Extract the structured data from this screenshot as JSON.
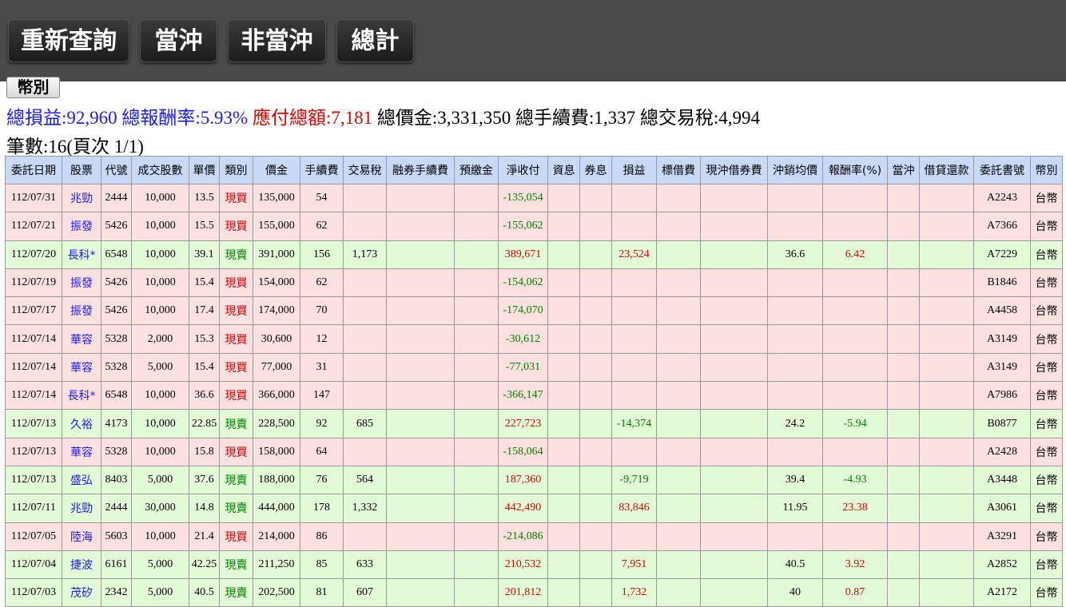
{
  "toolbar": {
    "requery": "重新查詢",
    "daytrade": "當沖",
    "nondaytrade": "非當沖",
    "total": "總計"
  },
  "currency_button": "幣別",
  "summary": {
    "total_pl": "總損益:92,960",
    "total_return": "總報酬率:5.93%",
    "total_payable": "應付總額:7,181",
    "total_amount": "總價金:3,331,350",
    "total_fee": "總手續費:1,337",
    "total_tax": "總交易稅:4,994"
  },
  "count_text": "筆數:16(頁次 1/1)",
  "table": {
    "headers": [
      "委託日期",
      "股票",
      "代號",
      "成交股數",
      "單價",
      "類別",
      "價金",
      "手續費",
      "交易稅",
      "融券手續費",
      "預繳金",
      "淨收付",
      "資息",
      "券息",
      "損益",
      "標借費",
      "現沖借券費",
      "沖銷均價",
      "報酬率(%)",
      "當沖",
      "借貸還款",
      "委託書號",
      "幣別"
    ],
    "rows": [
      {
        "type": "buy",
        "cells": [
          "112/07/31",
          "兆勁",
          "2444",
          "10,000",
          "13.5",
          "現買",
          "135,000",
          "54",
          "",
          "",
          "",
          "-135,054",
          "",
          "",
          "",
          "",
          "",
          "",
          "",
          "",
          "",
          "A2243",
          "台幣"
        ]
      },
      {
        "type": "buy",
        "cells": [
          "112/07/21",
          "振發",
          "5426",
          "10,000",
          "15.5",
          "現買",
          "155,000",
          "62",
          "",
          "",
          "",
          "-155,062",
          "",
          "",
          "",
          "",
          "",
          "",
          "",
          "",
          "",
          "A7366",
          "台幣"
        ]
      },
      {
        "type": "sell",
        "cells": [
          "112/07/20",
          "長科*",
          "6548",
          "10,000",
          "39.1",
          "現賣",
          "391,000",
          "156",
          "1,173",
          "",
          "",
          "389,671",
          "",
          "",
          "23,524",
          "",
          "",
          "36.6",
          "6.42",
          "",
          "",
          "A7229",
          "台幣"
        ]
      },
      {
        "type": "buy",
        "cells": [
          "112/07/19",
          "振發",
          "5426",
          "10,000",
          "15.4",
          "現買",
          "154,000",
          "62",
          "",
          "",
          "",
          "-154,062",
          "",
          "",
          "",
          "",
          "",
          "",
          "",
          "",
          "",
          "B1846",
          "台幣"
        ]
      },
      {
        "type": "buy",
        "cells": [
          "112/07/17",
          "振發",
          "5426",
          "10,000",
          "17.4",
          "現買",
          "174,000",
          "70",
          "",
          "",
          "",
          "-174,070",
          "",
          "",
          "",
          "",
          "",
          "",
          "",
          "",
          "",
          "A4458",
          "台幣"
        ]
      },
      {
        "type": "buy",
        "cells": [
          "112/07/14",
          "華容",
          "5328",
          "2,000",
          "15.3",
          "現買",
          "30,600",
          "12",
          "",
          "",
          "",
          "-30,612",
          "",
          "",
          "",
          "",
          "",
          "",
          "",
          "",
          "",
          "A3149",
          "台幣"
        ]
      },
      {
        "type": "buy",
        "cells": [
          "112/07/14",
          "華容",
          "5328",
          "5,000",
          "15.4",
          "現買",
          "77,000",
          "31",
          "",
          "",
          "",
          "-77,031",
          "",
          "",
          "",
          "",
          "",
          "",
          "",
          "",
          "",
          "A3149",
          "台幣"
        ]
      },
      {
        "type": "buy",
        "cells": [
          "112/07/14",
          "長科*",
          "6548",
          "10,000",
          "36.6",
          "現買",
          "366,000",
          "147",
          "",
          "",
          "",
          "-366,147",
          "",
          "",
          "",
          "",
          "",
          "",
          "",
          "",
          "",
          "A7986",
          "台幣"
        ]
      },
      {
        "type": "sell",
        "cells": [
          "112/07/13",
          "久裕",
          "4173",
          "10,000",
          "22.85",
          "現賣",
          "228,500",
          "92",
          "685",
          "",
          "",
          "227,723",
          "",
          "",
          "-14,374",
          "",
          "",
          "24.2",
          "-5.94",
          "",
          "",
          "B0877",
          "台幣"
        ]
      },
      {
        "type": "buy",
        "cells": [
          "112/07/13",
          "華容",
          "5328",
          "10,000",
          "15.8",
          "現買",
          "158,000",
          "64",
          "",
          "",
          "",
          "-158,064",
          "",
          "",
          "",
          "",
          "",
          "",
          "",
          "",
          "",
          "A2428",
          "台幣"
        ]
      },
      {
        "type": "sell",
        "cells": [
          "112/07/13",
          "盛弘",
          "8403",
          "5,000",
          "37.6",
          "現賣",
          "188,000",
          "76",
          "564",
          "",
          "",
          "187,360",
          "",
          "",
          "-9,719",
          "",
          "",
          "39.4",
          "-4.93",
          "",
          "",
          "A3448",
          "台幣"
        ]
      },
      {
        "type": "sell",
        "cells": [
          "112/07/11",
          "兆勁",
          "2444",
          "30,000",
          "14.8",
          "現賣",
          "444,000",
          "178",
          "1,332",
          "",
          "",
          "442,490",
          "",
          "",
          "83,846",
          "",
          "",
          "11.95",
          "23.38",
          "",
          "",
          "A3061",
          "台幣"
        ]
      },
      {
        "type": "buy",
        "cells": [
          "112/07/05",
          "陸海",
          "5603",
          "10,000",
          "21.4",
          "現買",
          "214,000",
          "86",
          "",
          "",
          "",
          "-214,086",
          "",
          "",
          "",
          "",
          "",
          "",
          "",
          "",
          "",
          "A3291",
          "台幣"
        ]
      },
      {
        "type": "sell",
        "cells": [
          "112/07/04",
          "捷波",
          "6161",
          "5,000",
          "42.25",
          "現賣",
          "211,250",
          "85",
          "633",
          "",
          "",
          "210,532",
          "",
          "",
          "7,951",
          "",
          "",
          "40.5",
          "3.92",
          "",
          "",
          "A2852",
          "台幣"
        ]
      },
      {
        "type": "sell",
        "cells": [
          "112/07/03",
          "茂矽",
          "2342",
          "5,000",
          "40.5",
          "現賣",
          "202,500",
          "81",
          "607",
          "",
          "",
          "201,812",
          "",
          "",
          "1,732",
          "",
          "",
          "40",
          "0.87",
          "",
          "",
          "A2172",
          "台幣"
        ]
      }
    ]
  },
  "colors": {
    "toolbar_bg": "#4a4a4a",
    "header_bg": "#c8daf7",
    "buy_row_bg": "#fde0e0",
    "sell_row_bg": "#e4fbd8",
    "link_blue": "#1a1aff",
    "loss_green": "#008000",
    "gain_red": "#e00000"
  }
}
